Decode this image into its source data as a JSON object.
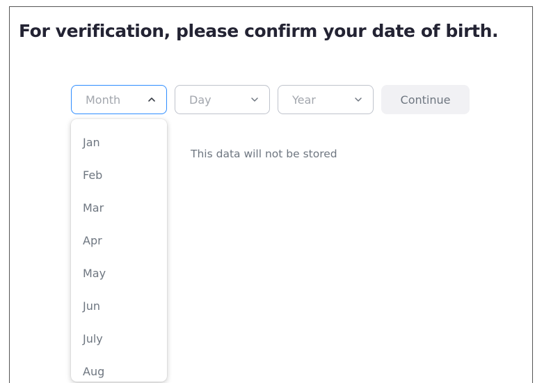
{
  "page": {
    "title": "For verification, please confirm your date of birth.",
    "note": "This data will not be stored"
  },
  "form": {
    "month": {
      "placeholder": "Month",
      "expanded": true,
      "icon": "chevron-up-icon"
    },
    "day": {
      "placeholder": "Day",
      "icon": "chevron-down-icon"
    },
    "year": {
      "placeholder": "Year",
      "icon": "chevron-down-icon"
    },
    "continue_label": "Continue"
  },
  "month_options": [
    "Jan",
    "Feb",
    "Mar",
    "Apr",
    "May",
    "Jun",
    "July",
    "Aug"
  ],
  "colors": {
    "focus_border": "#2d8cff",
    "title_text": "#232333",
    "muted_text": "#6e7680",
    "placeholder_text": "#a2a6ad",
    "button_bg": "#f1f1f4"
  }
}
